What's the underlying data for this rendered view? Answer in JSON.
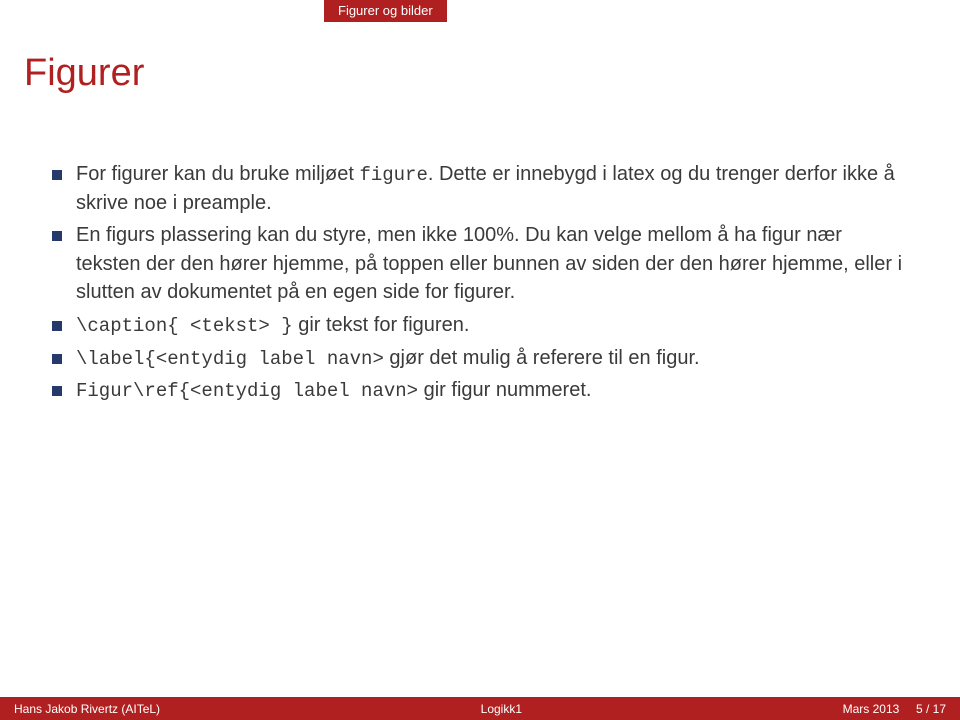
{
  "header": {
    "section": "Figurer og bilder"
  },
  "title": "Figurer",
  "bullets": [
    {
      "html": "For figurer kan du bruke miljøet <span class='tt'>figure</span>. Dette er innebygd i latex og du trenger derfor ikke å skrive noe i preample."
    },
    {
      "html": "En figurs plassering kan du styre, men ikke 100%. Du kan velge mellom å ha figur nær teksten der den hører hjemme, på toppen eller bunnen av siden der den hører hjemme, eller i slutten av dokumentet på en egen side for figurer."
    },
    {
      "html": "<span class='tt'>\\caption{ &lt;tekst&gt; }</span> gir tekst for figuren."
    },
    {
      "html": "<span class='tt'>\\label{&lt;entydig label navn&gt;</span> gjør det mulig å referere til en figur."
    },
    {
      "html": "<span class='tt'>Figur\\ref{&lt;entydig label navn&gt;</span> gir figur nummeret."
    }
  ],
  "footer": {
    "author": "Hans Jakob Rivertz (AITeL)",
    "short_title": "Logikk1",
    "date": "Mars 2013",
    "page": "5 / 17"
  }
}
